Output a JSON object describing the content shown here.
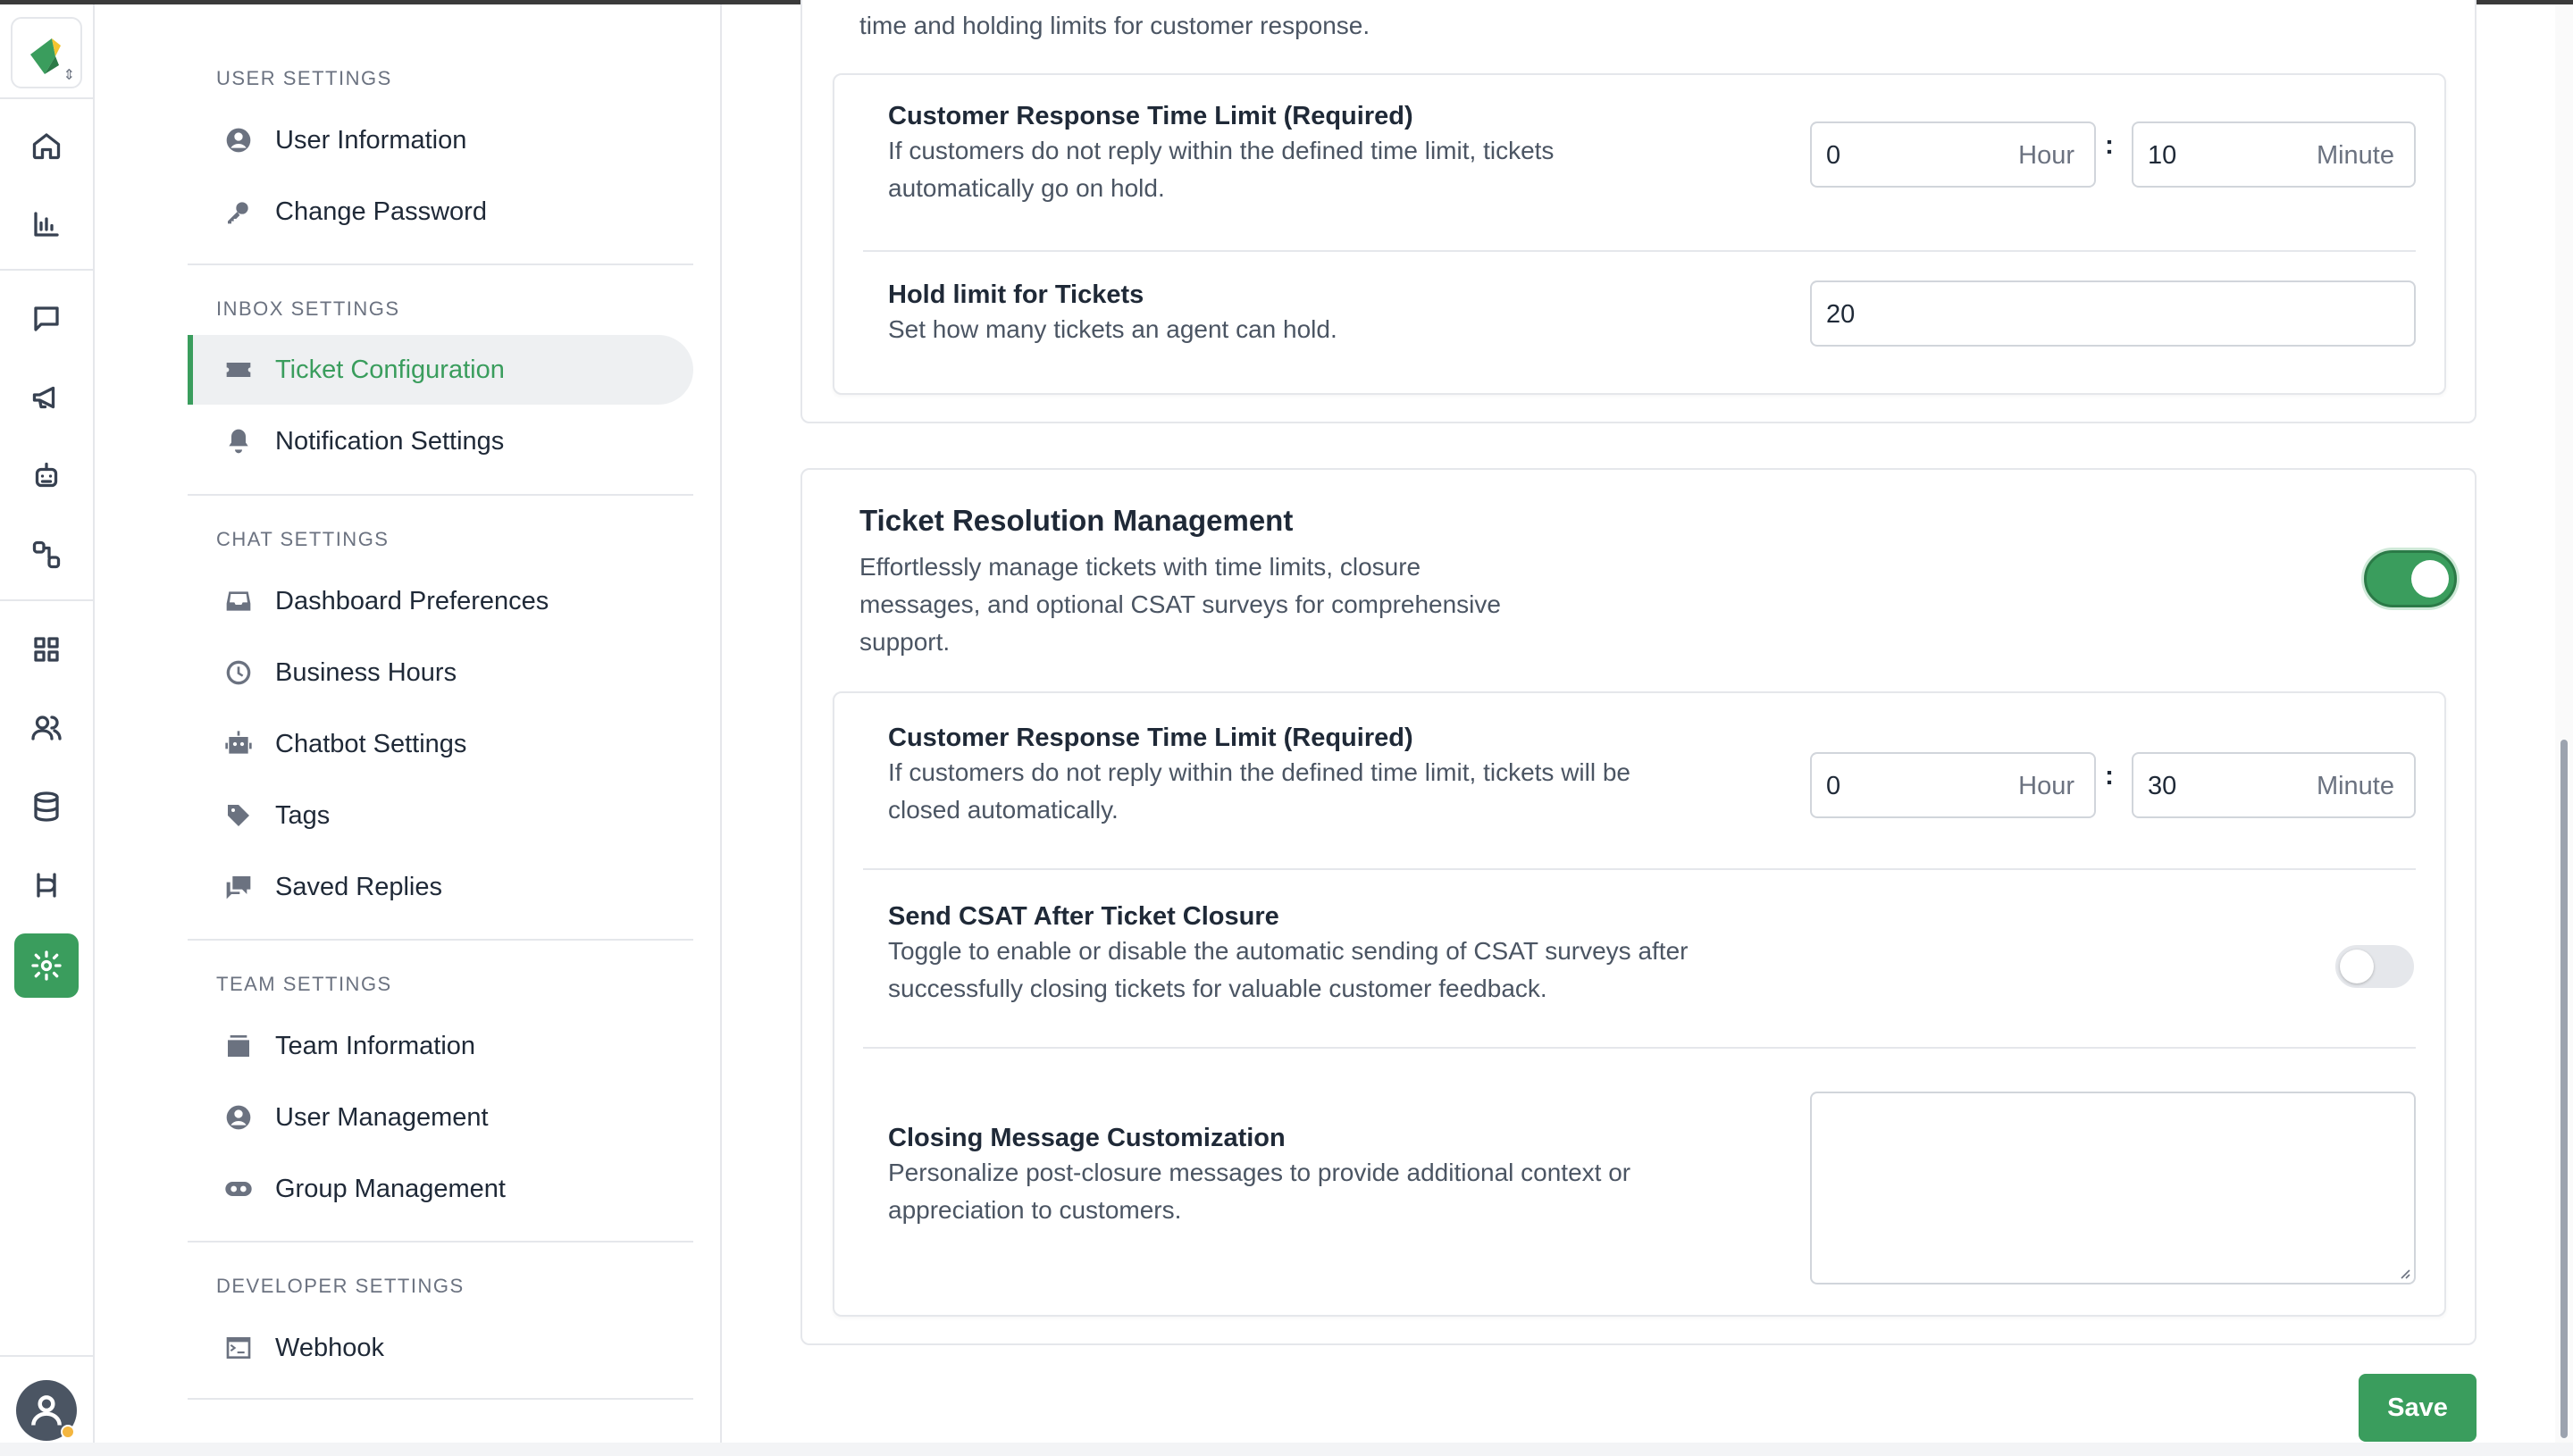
{
  "sidebar": {
    "sections": [
      {
        "title": "USER SETTINGS",
        "items": [
          {
            "label": "User Information",
            "icon": "user-circle-icon"
          },
          {
            "label": "Change Password",
            "icon": "key-icon"
          }
        ]
      },
      {
        "title": "INBOX SETTINGS",
        "items": [
          {
            "label": "Ticket Configuration",
            "icon": "ticket-icon",
            "active": true
          },
          {
            "label": "Notification Settings",
            "icon": "bell-icon"
          }
        ]
      },
      {
        "title": "CHAT SETTINGS",
        "items": [
          {
            "label": "Dashboard Preferences",
            "icon": "inbox-tray-icon"
          },
          {
            "label": "Business Hours",
            "icon": "clock-icon"
          },
          {
            "label": "Chatbot Settings",
            "icon": "robot-icon"
          },
          {
            "label": "Tags",
            "icon": "tag-icon"
          },
          {
            "label": "Saved Replies",
            "icon": "chat-bubbles-icon"
          }
        ]
      },
      {
        "title": "TEAM SETTINGS",
        "items": [
          {
            "label": "Team Information",
            "icon": "archive-icon"
          },
          {
            "label": "User Management",
            "icon": "user-circle-icon"
          },
          {
            "label": "Group Management",
            "icon": "group-icon"
          }
        ]
      },
      {
        "title": "DEVELOPER SETTINGS",
        "items": [
          {
            "label": "Webhook",
            "icon": "terminal-icon"
          }
        ]
      }
    ]
  },
  "rail": {
    "icons": [
      "home-icon",
      "bar-chart-icon",
      "chat-icon",
      "megaphone-icon",
      "bot-icon",
      "flow-icon",
      "grid-icon",
      "users-icon",
      "database-icon",
      "route-icon",
      "settings-icon"
    ],
    "active": "settings-icon"
  },
  "top_card": {
    "partial_text": "time and holding limits for customer response.",
    "response_limit": {
      "title": "Customer Response Time Limit (Required)",
      "desc_line1": "If customers do not reply within the defined time limit, tickets",
      "desc_line2": "automatically go on hold.",
      "hour_value": "0",
      "hour_unit": "Hour",
      "minute_value": "10",
      "minute_unit": "Minute",
      "separator": ":"
    },
    "hold_limit": {
      "title": "Hold limit for Tickets",
      "desc": "Set how many tickets an agent can hold.",
      "value": "20"
    }
  },
  "resolution_card": {
    "title": "Ticket Resolution Management",
    "desc_line1": "Effortlessly manage tickets with time limits, closure",
    "desc_line2": "messages, and optional CSAT surveys for comprehensive",
    "desc_line3": "support.",
    "enabled": true,
    "response_limit": {
      "title": "Customer Response Time Limit (Required)",
      "desc_line1": "If customers do not reply within the defined time limit, tickets will be",
      "desc_line2": "closed automatically.",
      "hour_value": "0",
      "hour_unit": "Hour",
      "minute_value": "30",
      "minute_unit": "Minute",
      "separator": ":"
    },
    "csat": {
      "title": "Send CSAT After Ticket Closure",
      "desc_line1": "Toggle to enable or disable the automatic sending of CSAT surveys after",
      "desc_line2": "successfully closing tickets for valuable customer feedback.",
      "enabled": false
    },
    "closing_message": {
      "title": "Closing Message Customization",
      "desc_line1": "Personalize post-closure messages to provide additional context or",
      "desc_line2": "appreciation to customers.",
      "value": ""
    }
  },
  "actions": {
    "save_label": "Save"
  },
  "colors": {
    "accent": "#3a9d5d",
    "border": "#e5e7eb",
    "text": "#1f2937",
    "muted": "#4b5563"
  }
}
